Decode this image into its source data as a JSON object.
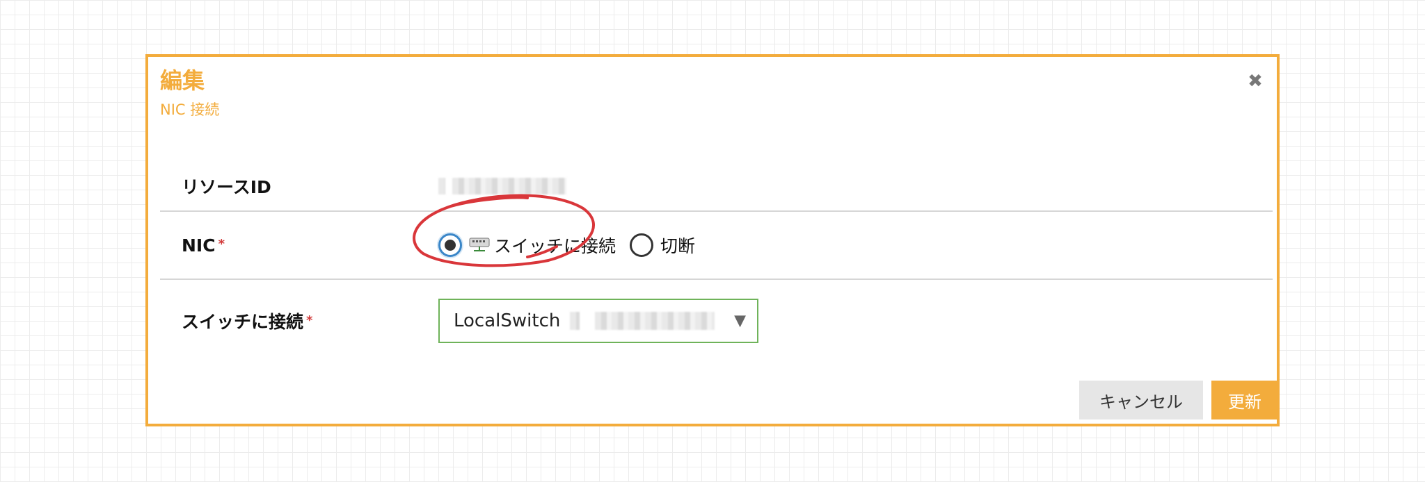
{
  "dialog": {
    "title": "編集",
    "subtitle": "NIC 接続",
    "close_icon": "close-icon"
  },
  "form": {
    "resource_id": {
      "label": "リソースID"
    },
    "nic": {
      "label": "NIC",
      "required_mark": "*",
      "options": [
        {
          "label": "スイッチに接続",
          "icon": "network-switch-icon",
          "checked": true
        },
        {
          "label": "切断",
          "checked": false
        }
      ]
    },
    "switch": {
      "label": "スイッチに接続",
      "required_mark": "*",
      "selected_value": "LocalSwitch"
    }
  },
  "buttons": {
    "cancel_label": "キャンセル",
    "update_label": "更新"
  },
  "colors": {
    "accent": "#f3ac3c",
    "required": "#d23a3a",
    "select_border": "#6fb35a",
    "radio_focus": "#3a86c8",
    "annotation": "#d9363a"
  }
}
